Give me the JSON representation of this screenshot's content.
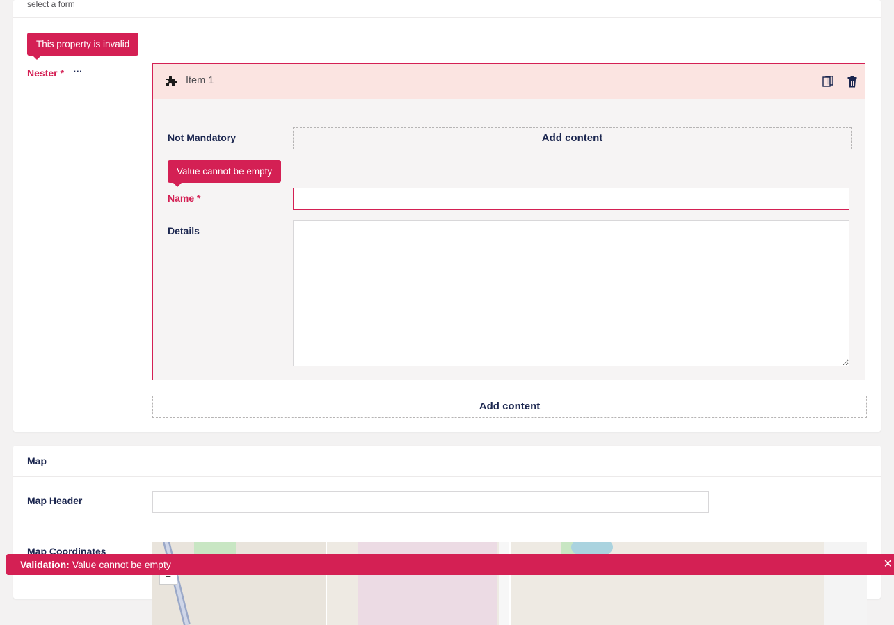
{
  "form_hint": "select a form",
  "nester": {
    "tooltip": "This property is invalid",
    "label": "Nester *",
    "more": "···",
    "item": {
      "title": "Item 1",
      "fields": {
        "not_mandatory_label": "Not Mandatory",
        "add_content": "Add content",
        "name_tooltip": "Value cannot be empty",
        "name_label": "Name *",
        "name_value": "",
        "details_label": "Details",
        "details_value": ""
      }
    },
    "add_content": "Add content"
  },
  "map_section": {
    "title": "Map",
    "header_label": "Map Header",
    "header_value": "",
    "coordinates_label": "Map Coordinates",
    "zoom_out": "−"
  },
  "toast": {
    "prefix": "Validation:",
    "message": "Value cannot be empty",
    "close": "✕"
  },
  "colors": {
    "error": "#d42054",
    "error_bg": "#fbe4e1",
    "text": "#1b264f"
  },
  "icons": [
    "puzzle-icon",
    "copy-icon",
    "trash-icon",
    "close-icon"
  ]
}
